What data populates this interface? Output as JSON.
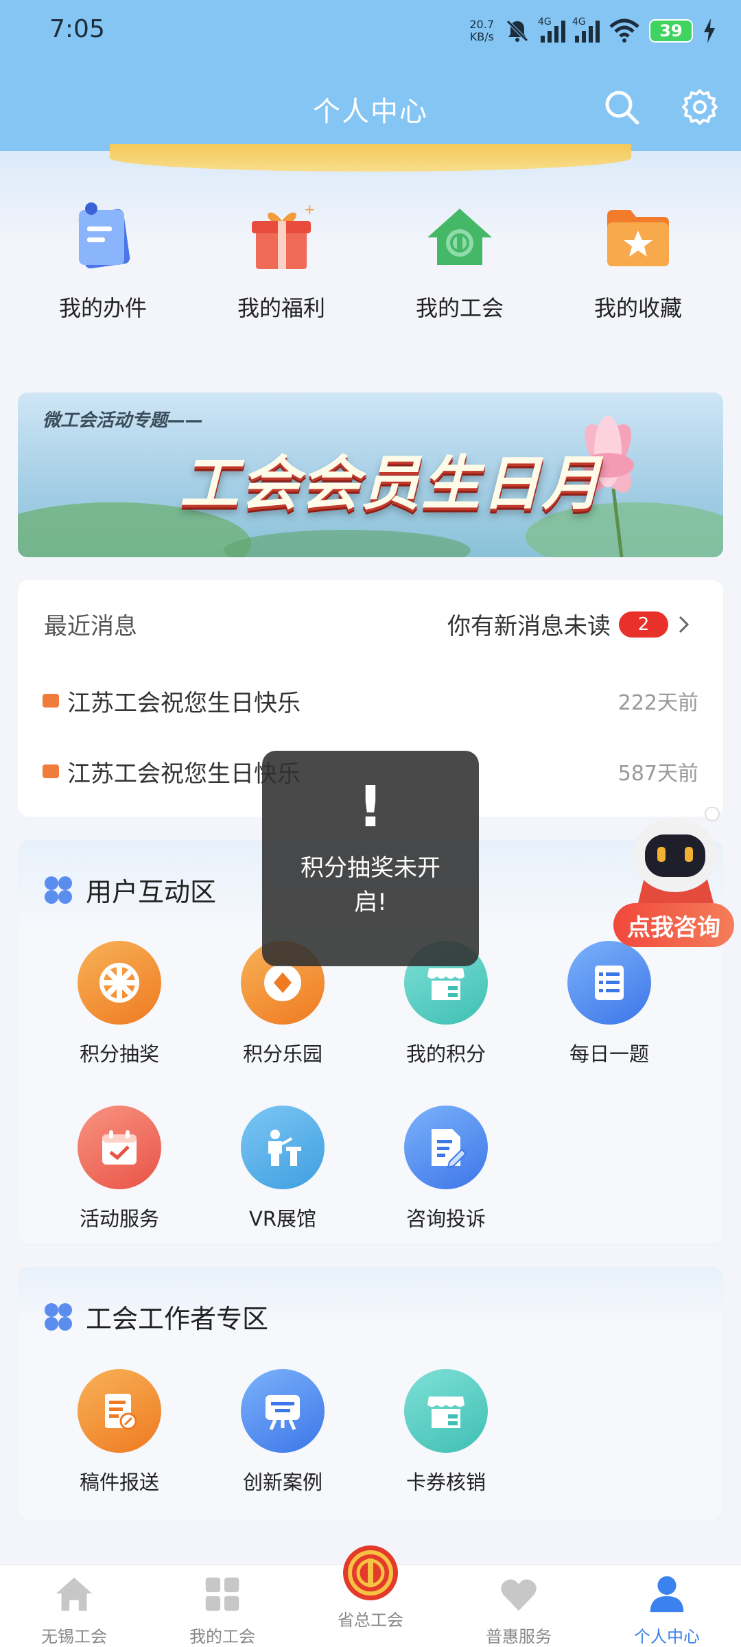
{
  "status_bar": {
    "time": "7:05",
    "net_speed_value": "20.7",
    "net_speed_unit": "KB/s",
    "network_1": "4G",
    "network_2": "4G",
    "battery": "39"
  },
  "header": {
    "title": "个人中心",
    "icons": [
      "search-icon",
      "gear-icon"
    ]
  },
  "quick_menu": [
    {
      "label": "我的办件",
      "icon": "document-icon"
    },
    {
      "label": "我的福利",
      "icon": "gift-icon"
    },
    {
      "label": "我的工会",
      "icon": "union-house-icon"
    },
    {
      "label": "我的收藏",
      "icon": "star-folder-icon"
    }
  ],
  "banner": {
    "subtitle": "微工会活动专题——",
    "title": "工会会员生日月"
  },
  "messages": {
    "heading": "最近消息",
    "unread_text": "你有新消息未读",
    "unread_count": "2",
    "items": [
      {
        "title": "江苏工会祝您生日快乐",
        "time": "222天前"
      },
      {
        "title": "江苏工会祝您生日快乐",
        "time": "587天前"
      }
    ]
  },
  "toast": {
    "mark": "!",
    "text": "积分抽奖未开启!"
  },
  "consult_bot": {
    "label": "点我咨询"
  },
  "section_user": {
    "title": "用户互动区",
    "items": [
      {
        "label": "积分抽奖",
        "icon": "wheel-icon"
      },
      {
        "label": "积分乐园",
        "icon": "coin-icon"
      },
      {
        "label": "我的积分",
        "icon": "shop-icon"
      },
      {
        "label": "每日一题",
        "icon": "quiz-icon"
      },
      {
        "label": "活动服务",
        "icon": "calendar-check-icon"
      },
      {
        "label": "VR展馆",
        "icon": "exhibit-icon"
      },
      {
        "label": "咨询投诉",
        "icon": "edit-document-icon"
      }
    ]
  },
  "section_worker": {
    "title": "工会工作者专区",
    "items": [
      {
        "label": "稿件报送",
        "icon": "submit-document-icon"
      },
      {
        "label": "创新案例",
        "icon": "case-board-icon"
      },
      {
        "label": "卡券核销",
        "icon": "shop-icon"
      }
    ]
  },
  "bottom_nav": [
    {
      "label": "无锡工会",
      "icon": "home-icon"
    },
    {
      "label": "我的工会",
      "icon": "grid-icon"
    },
    {
      "label": "省总工会",
      "icon": "union-emblem-icon"
    },
    {
      "label": "普惠服务",
      "icon": "heart-icon"
    },
    {
      "label": "个人中心",
      "icon": "person-icon",
      "active": true
    }
  ],
  "colors": {
    "header": "#85c5f4",
    "accent": "#3c82ee",
    "badge": "#e8312a"
  }
}
